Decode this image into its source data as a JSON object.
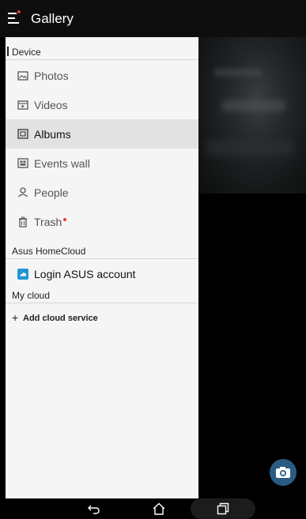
{
  "app": {
    "title": "Gallery"
  },
  "drawer": {
    "sections": {
      "device": "Device",
      "homecloud": "Asus HomeCloud",
      "mycloud": "My cloud"
    },
    "items": [
      {
        "label": "Photos",
        "icon": "photos-icon"
      },
      {
        "label": "Videos",
        "icon": "videos-icon"
      },
      {
        "label": "Albums",
        "icon": "albums-icon",
        "selected": true
      },
      {
        "label": "Events wall",
        "icon": "events-wall-icon"
      },
      {
        "label": "People",
        "icon": "people-icon"
      },
      {
        "label": "Trash",
        "icon": "trash-icon",
        "badge": true
      }
    ],
    "login": {
      "label": "Login ASUS account",
      "icon": "asus-cloud-icon"
    },
    "add_cloud": {
      "label": "Add cloud service",
      "icon": "plus-icon"
    }
  },
  "colors": {
    "accent_red": "#e53935",
    "selected_bg": "#e2e2e2",
    "fab_blue": "#2c5b82",
    "asus_icon_blue": "#2196d3"
  },
  "navbar": {
    "buttons": [
      "back-icon",
      "home-icon",
      "recents-icon"
    ]
  }
}
